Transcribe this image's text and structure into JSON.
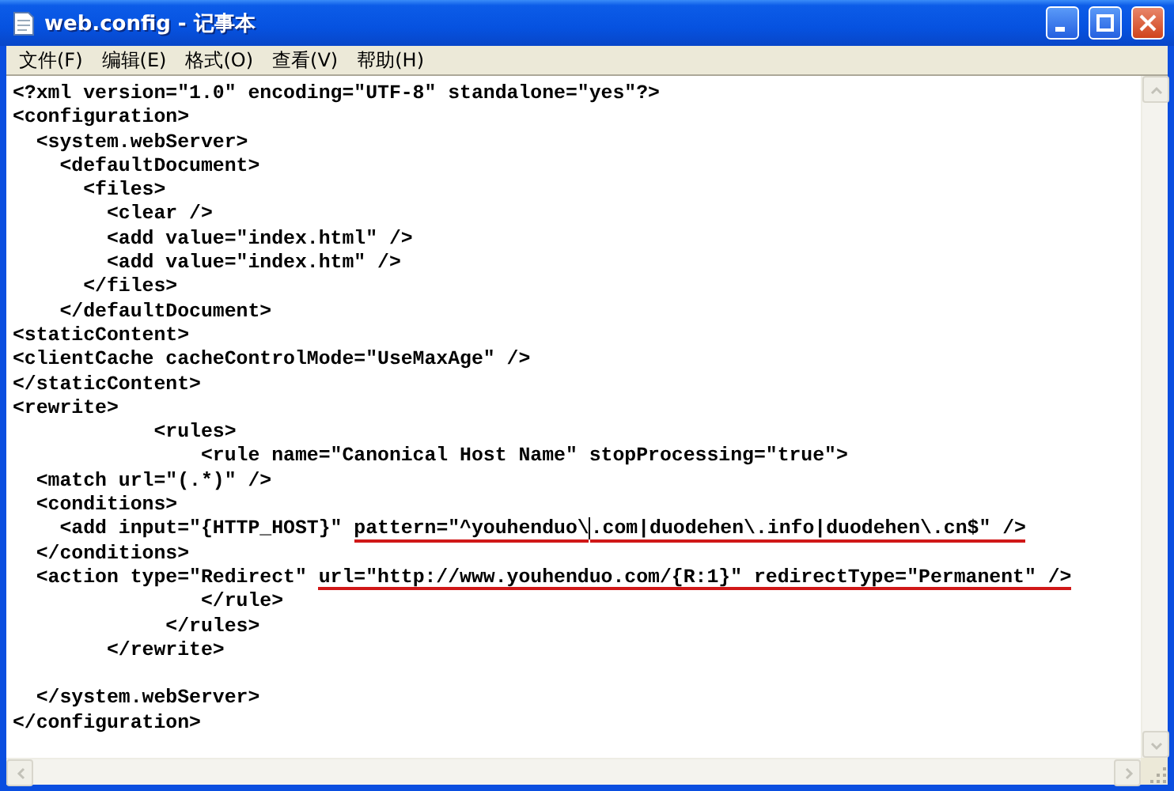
{
  "window": {
    "title": "web.config - 记事本"
  },
  "menu": [
    "文件(F)",
    "编辑(E)",
    "格式(O)",
    "查看(V)",
    "帮助(H)"
  ],
  "lines": [
    {
      "segments": [
        {
          "kind": "text",
          "text": "<?xml version=\"1.0\" encoding=\"UTF-8\" standalone=\"yes\"?>",
          "underlined": false
        }
      ]
    },
    {
      "segments": [
        {
          "kind": "text",
          "text": "<configuration>",
          "underlined": false
        }
      ]
    },
    {
      "segments": [
        {
          "kind": "text",
          "text": "  <system.webServer>",
          "underlined": false
        }
      ]
    },
    {
      "segments": [
        {
          "kind": "text",
          "text": "    <defaultDocument>",
          "underlined": false
        }
      ]
    },
    {
      "segments": [
        {
          "kind": "text",
          "text": "      <files>",
          "underlined": false
        }
      ]
    },
    {
      "segments": [
        {
          "kind": "text",
          "text": "        <clear />",
          "underlined": false
        }
      ]
    },
    {
      "segments": [
        {
          "kind": "text",
          "text": "        <add value=\"index.html\" />",
          "underlined": false
        }
      ]
    },
    {
      "segments": [
        {
          "kind": "text",
          "text": "        <add value=\"index.htm\" />",
          "underlined": false
        }
      ]
    },
    {
      "segments": [
        {
          "kind": "text",
          "text": "      </files>",
          "underlined": false
        }
      ]
    },
    {
      "segments": [
        {
          "kind": "text",
          "text": "    </defaultDocument>",
          "underlined": false
        }
      ]
    },
    {
      "segments": [
        {
          "kind": "text",
          "text": "<staticContent>",
          "underlined": false
        }
      ]
    },
    {
      "segments": [
        {
          "kind": "text",
          "text": "<clientCache cacheControlMode=\"UseMaxAge\" />",
          "underlined": false
        }
      ]
    },
    {
      "segments": [
        {
          "kind": "text",
          "text": "</staticContent>",
          "underlined": false
        }
      ]
    },
    {
      "segments": [
        {
          "kind": "text",
          "text": "<rewrite>",
          "underlined": false
        }
      ]
    },
    {
      "segments": [
        {
          "kind": "text",
          "text": "            <rules>",
          "underlined": false
        }
      ]
    },
    {
      "segments": [
        {
          "kind": "text",
          "text": "                <rule name=\"Canonical Host Name\" stopProcessing=\"true\">",
          "underlined": false
        }
      ]
    },
    {
      "segments": [
        {
          "kind": "text",
          "text": "  <match url=\"(.*)\" />",
          "underlined": false
        }
      ]
    },
    {
      "segments": [
        {
          "kind": "text",
          "text": "  <conditions>",
          "underlined": false
        }
      ]
    },
    {
      "segments": [
        {
          "kind": "text",
          "text": "    <add input=\"{HTTP_HOST}\" ",
          "underlined": false
        },
        {
          "kind": "text",
          "text": "pattern=\"^youhenduo\\",
          "underlined": true
        },
        {
          "kind": "caret"
        },
        {
          "kind": "text",
          "text": ".com|duodehen\\.info|duodehen\\.cn$\" />",
          "underlined": true
        }
      ]
    },
    {
      "segments": [
        {
          "kind": "text",
          "text": "  </conditions>",
          "underlined": false
        }
      ]
    },
    {
      "segments": [
        {
          "kind": "text",
          "text": "  <action type=\"Redirect\" ",
          "underlined": false
        },
        {
          "kind": "text",
          "text": "url=\"http://www.youhenduo.com/{R:1}\" redirectType=\"Permanent\" />",
          "underlined": true
        }
      ]
    },
    {
      "segments": [
        {
          "kind": "text",
          "text": "                </rule>",
          "underlined": false
        }
      ]
    },
    {
      "segments": [
        {
          "kind": "text",
          "text": "             </rules>",
          "underlined": false
        }
      ]
    },
    {
      "segments": [
        {
          "kind": "text",
          "text": "        </rewrite>",
          "underlined": false
        }
      ]
    },
    {
      "blank_before": true,
      "segments": [
        {
          "kind": "text",
          "text": "  </system.webServer>",
          "underlined": false
        }
      ]
    },
    {
      "segments": [
        {
          "kind": "text",
          "text": "</configuration>",
          "underlined": false
        }
      ]
    }
  ]
}
